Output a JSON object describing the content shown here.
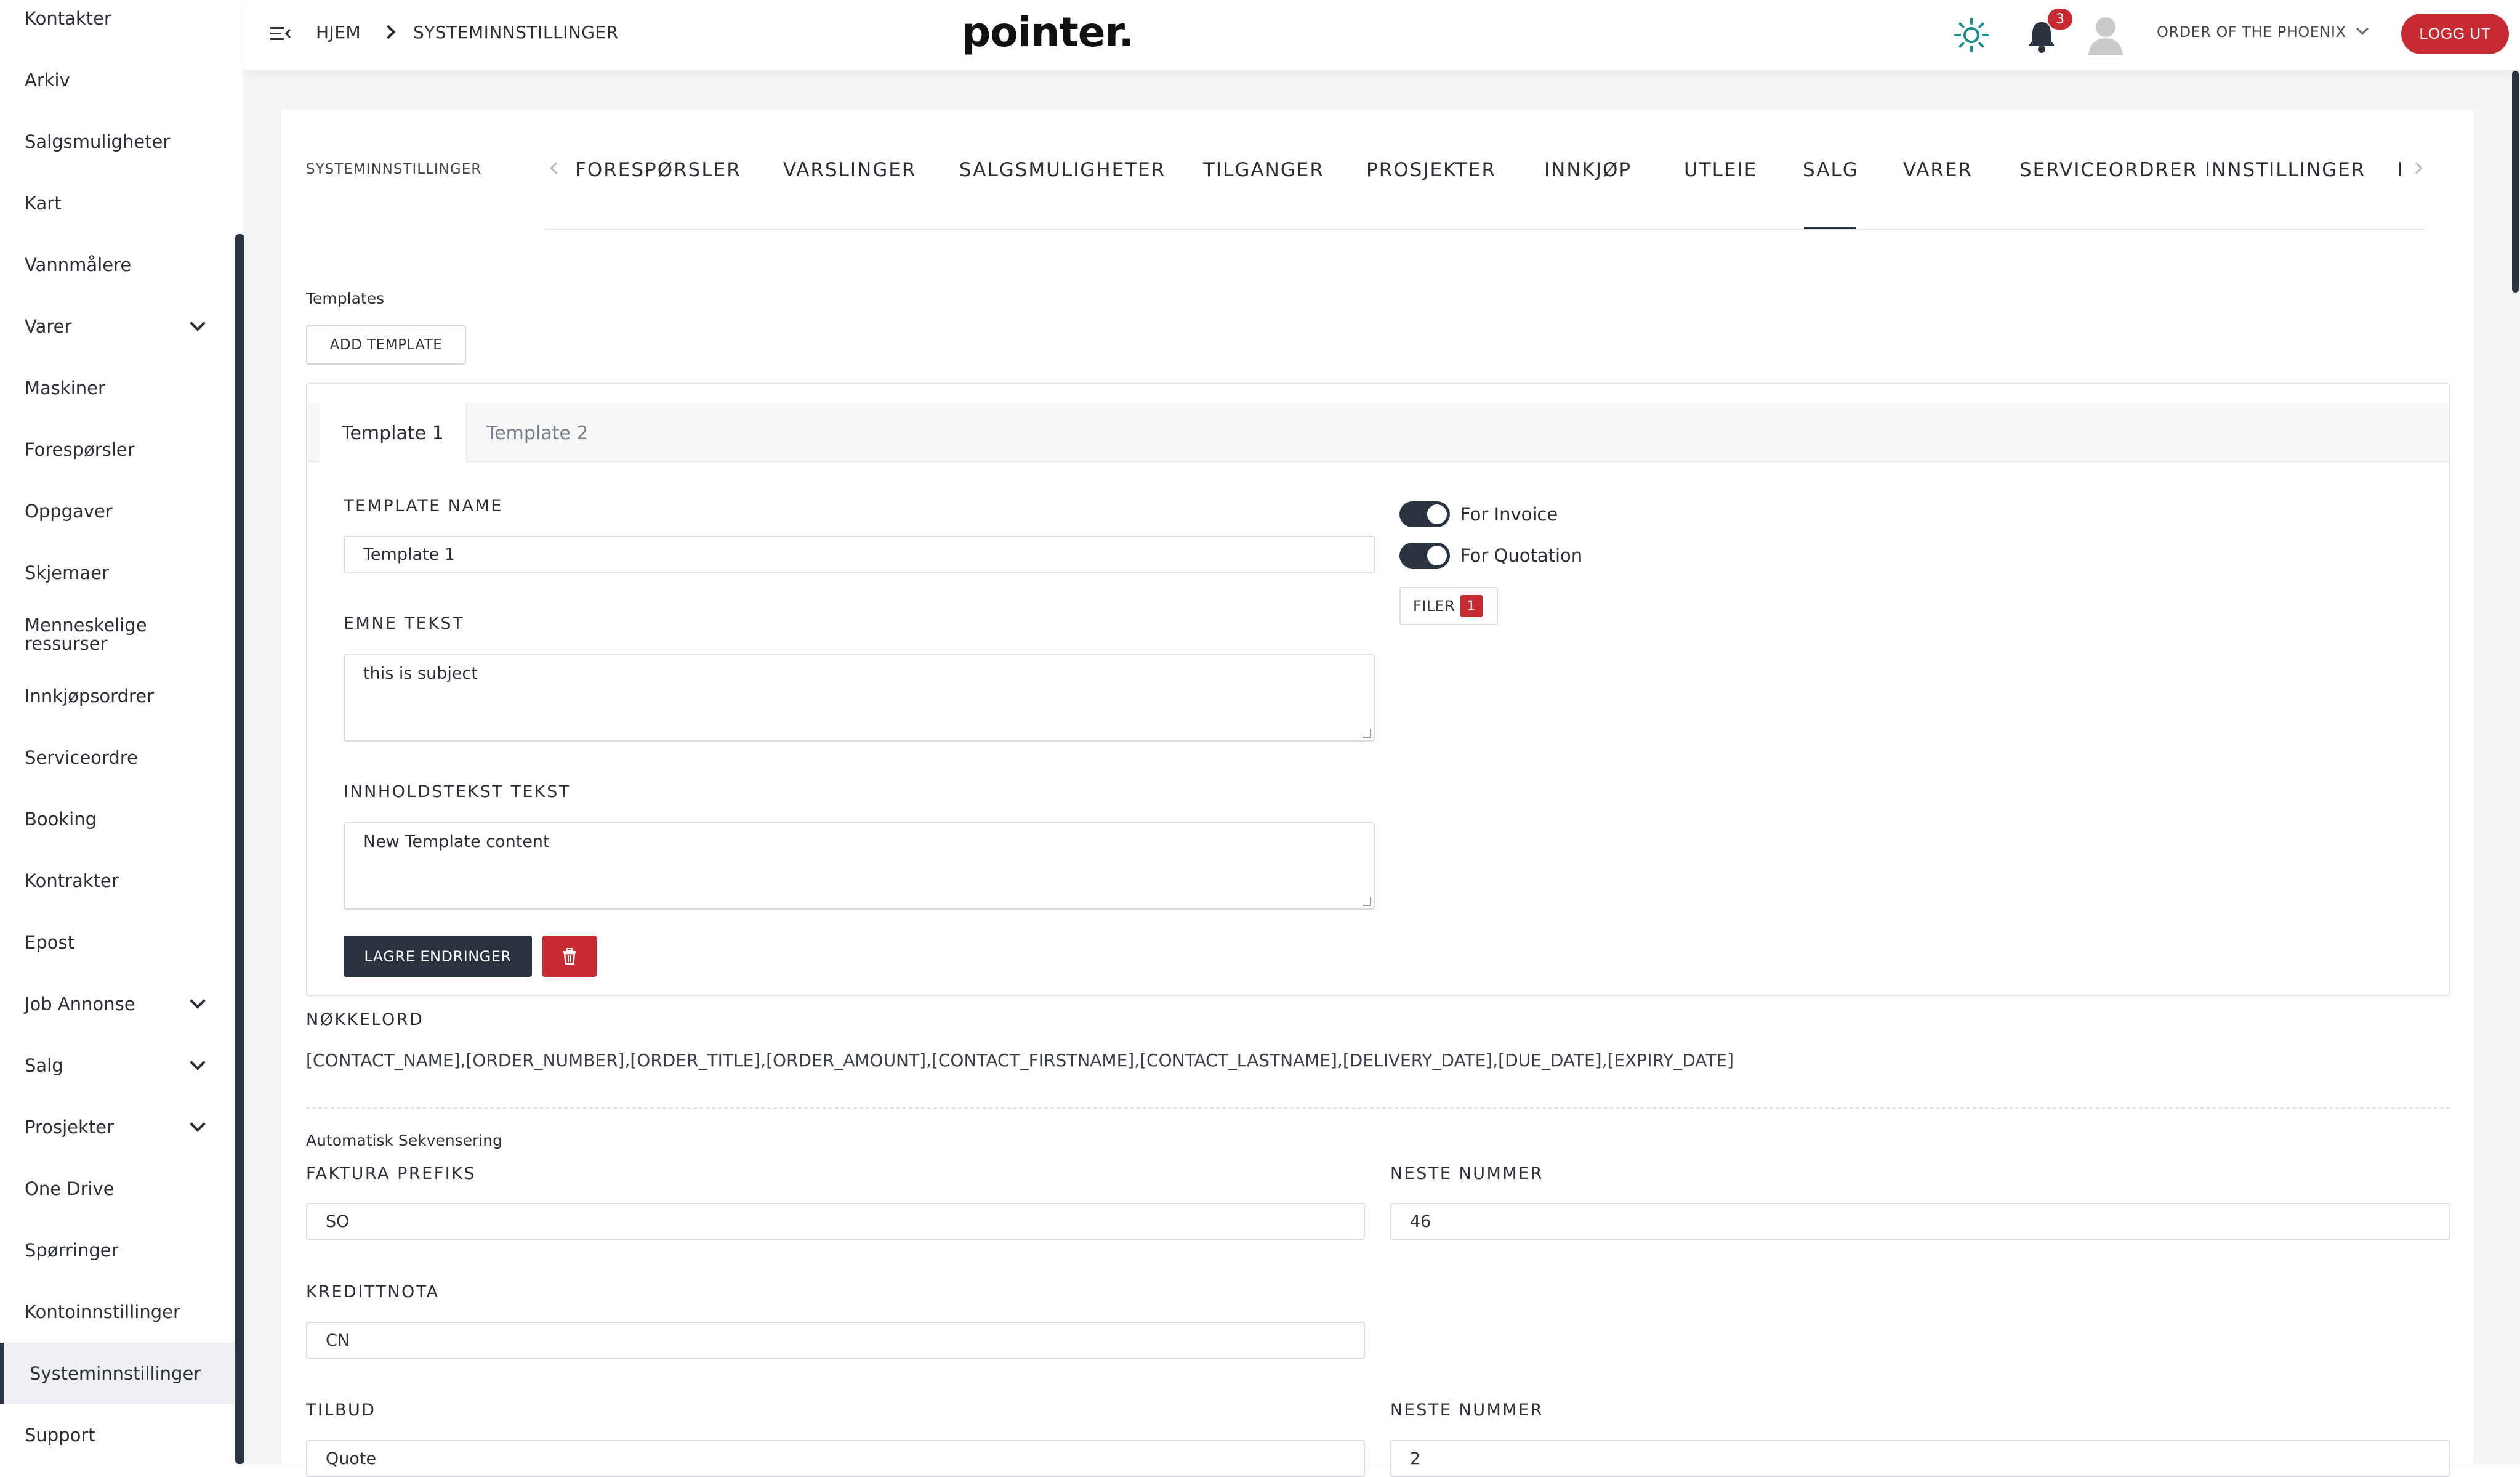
{
  "sidebar": {
    "items": [
      {
        "label": "Kontakter"
      },
      {
        "label": "Arkiv"
      },
      {
        "label": "Salgsmuligheter"
      },
      {
        "label": "Kart"
      },
      {
        "label": "Vannmålere"
      },
      {
        "label": "Varer",
        "expandable": true
      },
      {
        "label": "Maskiner"
      },
      {
        "label": "Forespørsler"
      },
      {
        "label": "Oppgaver"
      },
      {
        "label": "Skjemaer"
      },
      {
        "label": "Menneskelige ressurser"
      },
      {
        "label": "Innkjøpsordrer"
      },
      {
        "label": "Serviceordre"
      },
      {
        "label": "Booking"
      },
      {
        "label": "Kontrakter"
      },
      {
        "label": "Epost"
      },
      {
        "label": "Job Annonse",
        "expandable": true
      },
      {
        "label": "Salg",
        "expandable": true
      },
      {
        "label": "Prosjekter",
        "expandable": true
      },
      {
        "label": "One Drive"
      },
      {
        "label": "Spørringer"
      },
      {
        "label": "Kontoinnstillinger"
      },
      {
        "label": "Systeminnstillinger",
        "active": true
      },
      {
        "label": "Support"
      }
    ]
  },
  "topbar": {
    "breadcrumb": [
      "HJEM",
      "SYSTEMINNSTILLINGER"
    ],
    "logo": "pointer.",
    "notification_count": "3",
    "organization": "ORDER OF THE PHOENIX",
    "logout_label": "LOGG UT"
  },
  "settings": {
    "header_title": "SYSTEMINNSTILLINGER",
    "tabs": [
      {
        "label": "FORESPØRSLER"
      },
      {
        "label": "VARSLINGER"
      },
      {
        "label": "SALGSMULIGHETER"
      },
      {
        "label": "TILGANGER"
      },
      {
        "label": "PROSJEKTER"
      },
      {
        "label": "INNKJØP"
      },
      {
        "label": "UTLEIE"
      },
      {
        "label": "SALG",
        "active": true
      },
      {
        "label": "VARER"
      },
      {
        "label": "SERVICEORDRER INNSTILLINGER"
      },
      {
        "label": "I"
      }
    ]
  },
  "templates": {
    "section_label": "Templates",
    "add_button": "ADD TEMPLATE",
    "tabs": [
      {
        "label": "Template 1",
        "active": true
      },
      {
        "label": "Template 2"
      }
    ],
    "form": {
      "name_label": "TEMPLATE NAME",
      "name_value": "Template 1",
      "subject_label": "EMNE TEKST",
      "subject_value": "this is subject",
      "content_label": "INNHOLDSTEKST TEKST",
      "content_value": "New Template content",
      "for_invoice_label": "For Invoice",
      "for_invoice": true,
      "for_quotation_label": "For Quotation",
      "for_quotation": true,
      "files_label": "FILER",
      "files_count": "1",
      "save_label": "LAGRE ENDRINGER"
    }
  },
  "keywords": {
    "label": "NØKKELORD",
    "value": "[CONTACT_NAME],[ORDER_NUMBER],[ORDER_TITLE],[ORDER_AMOUNT],[CONTACT_FIRSTNAME],[CONTACT_LASTNAME],[DELIVERY_DATE],[DUE_DATE],[EXPIRY_DATE]"
  },
  "sequencing": {
    "section_label": "Automatisk Sekvensering",
    "invoice_prefix_label": "FAKTURA PREFIKS",
    "invoice_prefix_value": "SO",
    "invoice_next_label": "NESTE NUMMER",
    "invoice_next_value": "46",
    "credit_note_label": "KREDITTNOTA",
    "credit_note_value": "CN",
    "quote_label": "TILBUD",
    "quote_value": "Quote",
    "quote_next_label": "NESTE NUMMER",
    "quote_next_value": "2"
  },
  "colors": {
    "primary_dark": "#2a3441",
    "danger": "#c72b32",
    "accent_teal": "#1a8f8a"
  }
}
